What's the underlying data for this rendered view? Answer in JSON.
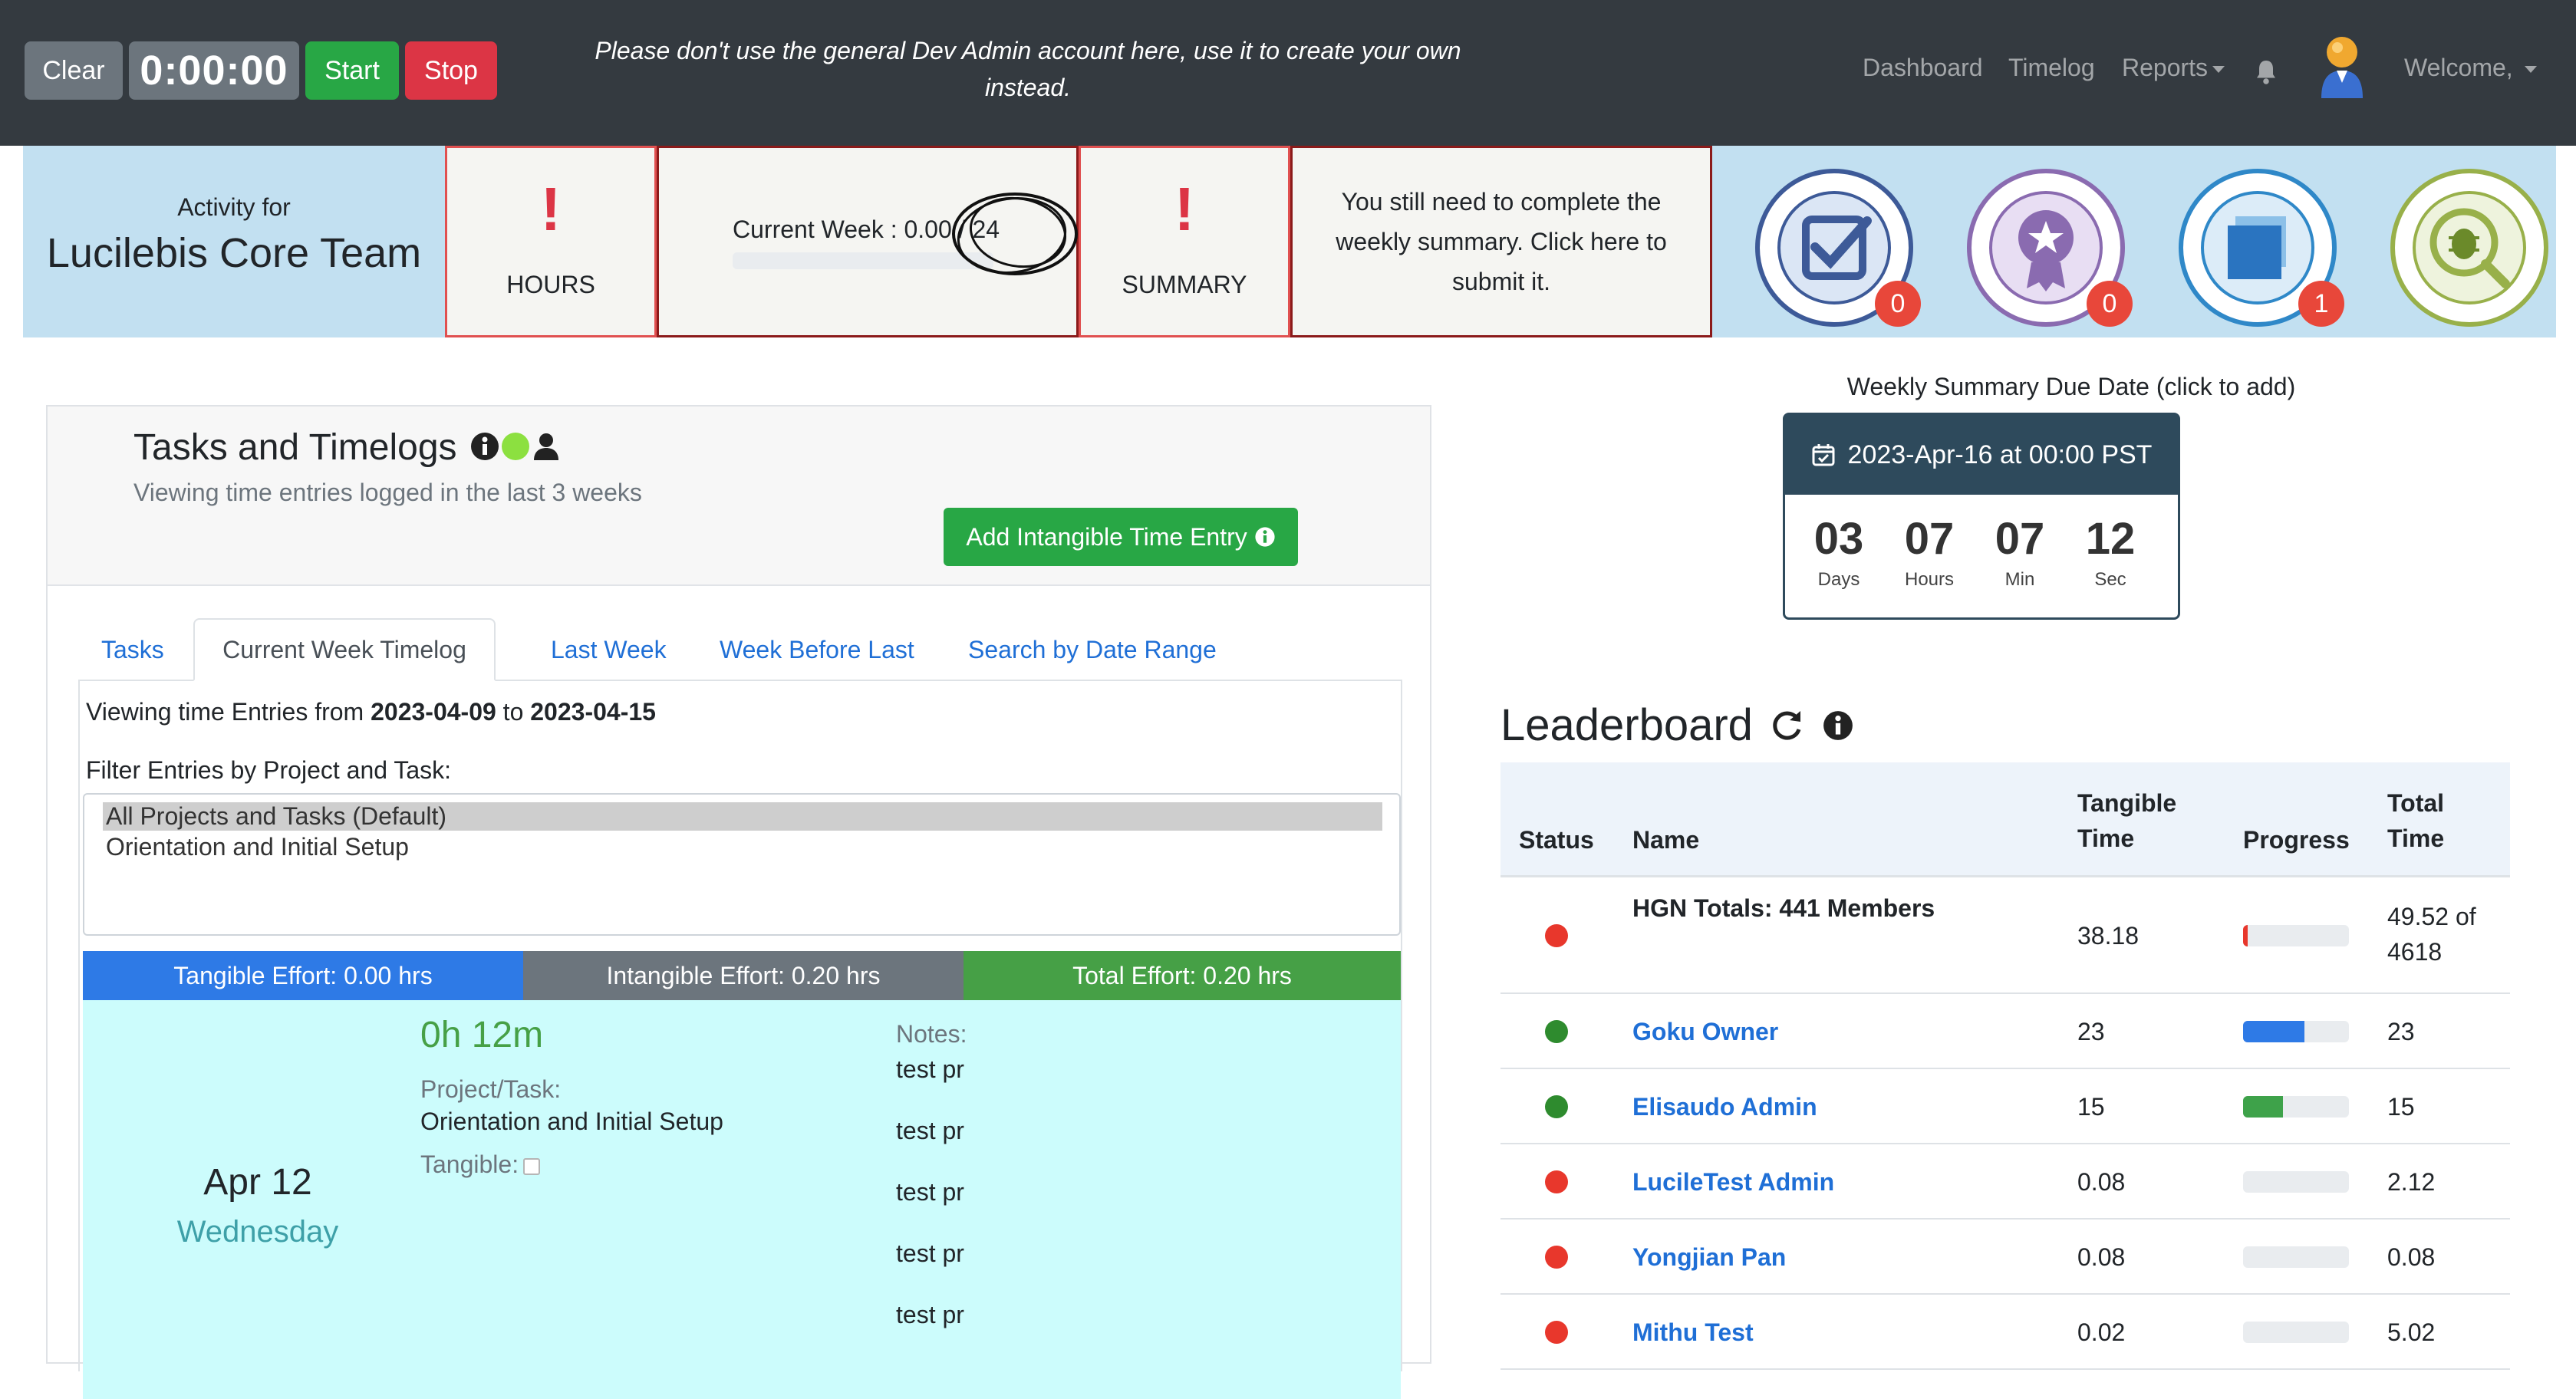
{
  "navbar": {
    "clear_label": "Clear",
    "timer": "0:00:00",
    "start_label": "Start",
    "stop_label": "Stop",
    "warning": "Please don't use the general Dev Admin account here, use it to create your own instead.",
    "links": {
      "dashboard": "Dashboard",
      "timelog": "Timelog",
      "reports": "Reports",
      "welcome": "Welcome,"
    }
  },
  "activity": {
    "for_label": "Activity for",
    "team_name": "Lucilebis Core Team",
    "hours_mark": "!",
    "hours_label": "HOURS",
    "current_week": "Current Week : 0.00 / 24",
    "current_week_progress": 0,
    "summary_mark": "!",
    "summary_label": "SUMMARY",
    "summary_message": "You still need to complete the weekly summary. Click here to submit it."
  },
  "badges": [
    {
      "name": "tasks-why-criteria-endstate-badge",
      "count": "0",
      "color": "#3d5a98"
    },
    {
      "name": "badges-earned-badge",
      "count": "0",
      "color": "#8a6bb0"
    },
    {
      "name": "blue-square-record-badge",
      "count": "1",
      "color": "#2f88c8"
    },
    {
      "name": "report-app-bug-badge",
      "count": "",
      "color": "#98b04a"
    }
  ],
  "tasks_panel": {
    "title": "Tasks and Timelogs",
    "subtitle": "Viewing time entries logged in the last 3 weeks",
    "add_button": "Add Intangible Time Entry",
    "tabs": [
      "Tasks",
      "Current Week Timelog",
      "Last Week",
      "Week Before Last",
      "Search by Date Range"
    ],
    "active_tab": "Current Week Timelog",
    "viewing_prefix": "Viewing time Entries from ",
    "viewing_from": "2023-04-09",
    "viewing_to_word": " to ",
    "viewing_to": "2023-04-15",
    "filter_label": "Filter Entries by Project and Task:",
    "filter_options": [
      "All Projects and Tasks (Default)",
      "Orientation and Initial Setup"
    ],
    "filter_selected": "All Projects and Tasks (Default)",
    "effort": {
      "tangible": "Tangible Effort: 0.00 hrs",
      "intangible": "Intangible Effort: 0.20 hrs",
      "total": "Total Effort: 0.20 hrs"
    },
    "entry": {
      "date": "Apr 12",
      "day": "Wednesday",
      "duration": "0h 12m",
      "project_label": "Project/Task:",
      "project_value": "Orientation and Initial Setup",
      "tangible_label": "Tangible:",
      "tangible_checked": false,
      "notes_label": "Notes:",
      "notes": [
        "test pr",
        "test pr",
        "test pr",
        "test pr",
        "test pr"
      ]
    }
  },
  "due_date": {
    "label": "Weekly Summary Due Date (click to add)",
    "date": "2023-Apr-16 at 00:00 PST",
    "countdown": [
      {
        "value": "03",
        "unit": "Days"
      },
      {
        "value": "07",
        "unit": "Hours"
      },
      {
        "value": "07",
        "unit": "Min"
      },
      {
        "value": "12",
        "unit": "Sec"
      }
    ]
  },
  "leaderboard": {
    "title": "Leaderboard",
    "headers": {
      "status": "Status",
      "name": "Name",
      "tangible": "Tangible Time",
      "progress": "Progress",
      "total": "Total Time"
    },
    "rows": [
      {
        "status_color": "#e8372c",
        "name": "HGN Totals: 441 Members",
        "is_link": false,
        "tangible": "38.18",
        "progress": 0.04,
        "progress_color": "#e8372c",
        "total": "49.52 of 4618"
      },
      {
        "status_color": "#2e8b2e",
        "name": "Goku Owner",
        "is_link": true,
        "tangible": "23",
        "progress": 0.58,
        "progress_color": "#2e7ae6",
        "total": "23"
      },
      {
        "status_color": "#2e8b2e",
        "name": "Elisaudo Admin",
        "is_link": true,
        "tangible": "15",
        "progress": 0.38,
        "progress_color": "#3ea24a",
        "total": "15"
      },
      {
        "status_color": "#e8372c",
        "name": "LucileTest Admin",
        "is_link": true,
        "tangible": "0.08",
        "progress": 0,
        "progress_color": "#e8372c",
        "total": "2.12"
      },
      {
        "status_color": "#e8372c",
        "name": "Yongjian Pan",
        "is_link": true,
        "tangible": "0.08",
        "progress": 0,
        "progress_color": "#e8372c",
        "total": "0.08"
      },
      {
        "status_color": "#e8372c",
        "name": "Mithu Test",
        "is_link": true,
        "tangible": "0.02",
        "progress": 0,
        "progress_color": "#e8372c",
        "total": "5.02"
      }
    ]
  }
}
